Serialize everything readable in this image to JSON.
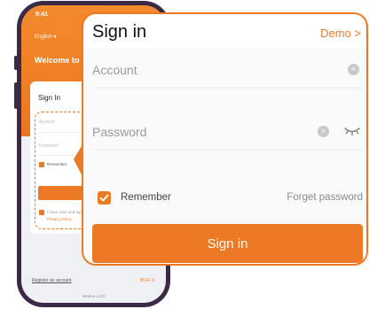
{
  "phone": {
    "status_time": "9:41",
    "status_icons": "▮ ◔ ▬",
    "language": "English ▾",
    "welcome": "Welcome to",
    "card_title": "Sign In",
    "account_placeholder": "Account",
    "password_placeholder": "Password",
    "remember": "Remember",
    "agree": "I have read and agree",
    "privacy": "Privacy Policy",
    "footer_left": "Register an account",
    "footer_right": "Wi-Fi ⊙",
    "footer_center": "Version 1.0.0"
  },
  "zoom": {
    "title": "Sign in",
    "demo_link": "Demo >",
    "account_placeholder": "Account",
    "password_placeholder": "Password",
    "clear_glyph": "×",
    "remember_label": "Remember",
    "remember_checked": true,
    "forget_password": "Forget password",
    "signin_button": "Sign in"
  },
  "colors": {
    "accent": "#ec7a25",
    "phone_frame": "#3b2a45"
  },
  "icons": {
    "clear": "clear-circle-icon",
    "password_visibility": "eye-closed-icon",
    "checkbox": "checkmark-icon"
  }
}
